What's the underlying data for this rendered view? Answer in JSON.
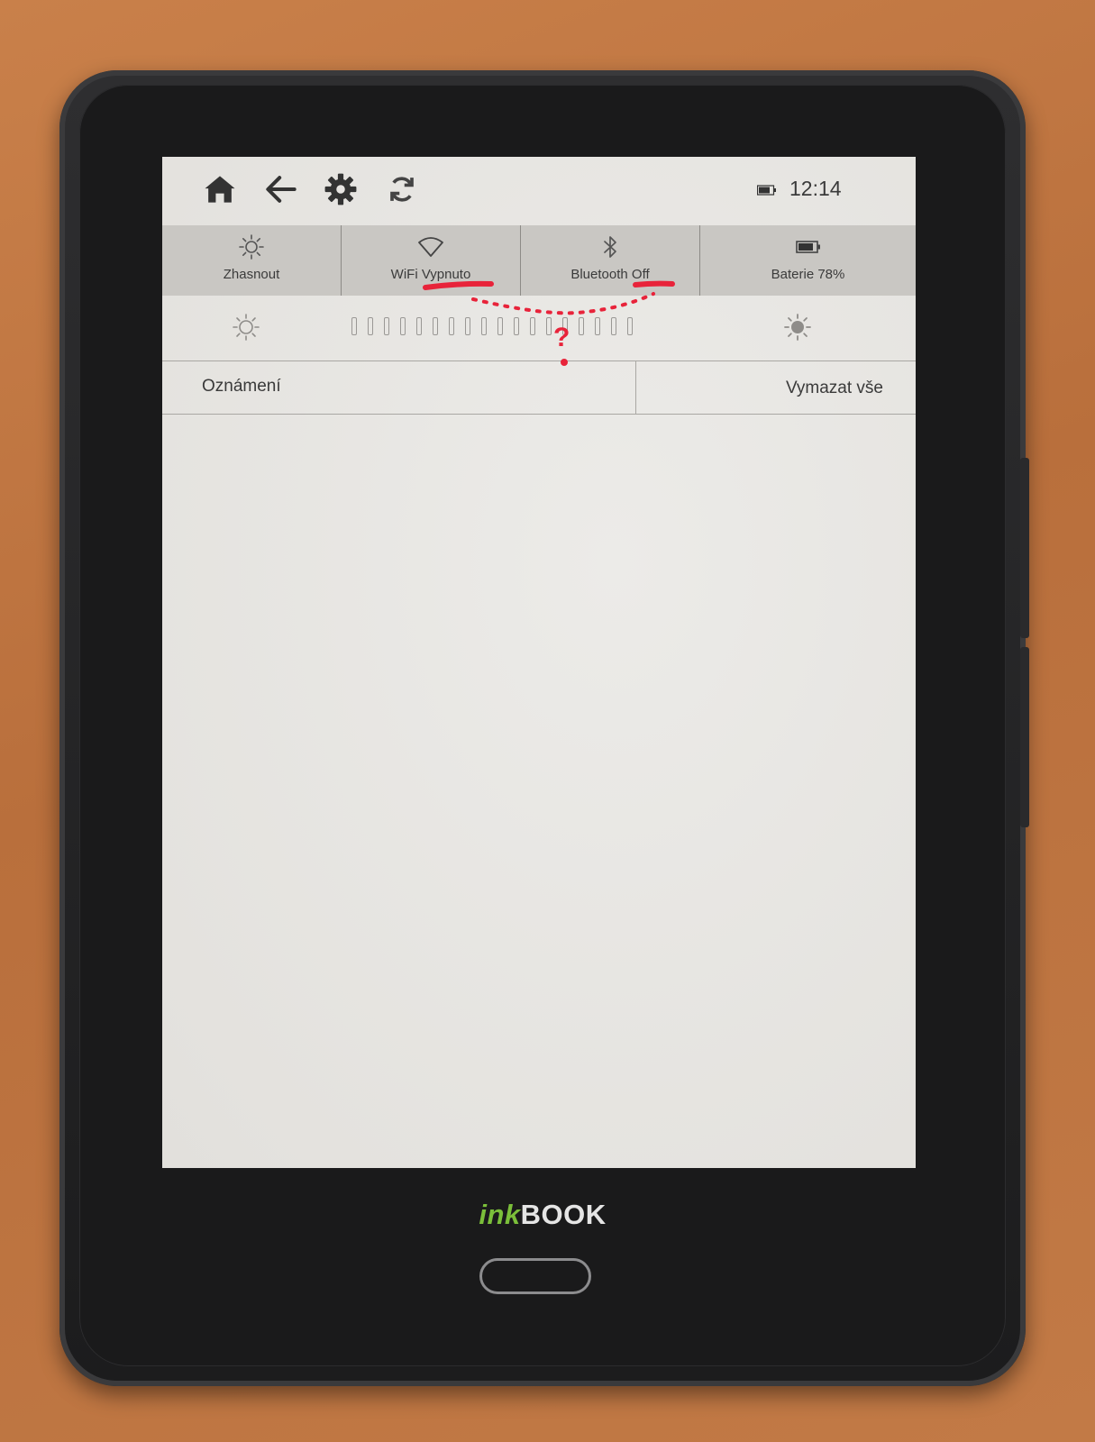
{
  "statusbar": {
    "icons": [
      "home-icon",
      "back-arrow-icon",
      "settings-gear-icon",
      "sync-icon"
    ],
    "battery_icon": "battery-icon",
    "time": "12:14"
  },
  "quick_settings": {
    "tiles": [
      {
        "icon": "sun-outline-icon",
        "label": "Zhasnout"
      },
      {
        "icon": "wifi-icon",
        "label": "WiFi Vypnuto"
      },
      {
        "icon": "bluetooth-icon",
        "label": "Bluetooth Off"
      },
      {
        "icon": "battery-icon",
        "label": "Baterie 78%"
      }
    ]
  },
  "brightness": {
    "segments_total": 18,
    "level_fraction": 0.0
  },
  "notifications": {
    "title": "Oznámení",
    "clear_all": "Vymazat vše",
    "items": []
  },
  "annotation": {
    "mark": "?",
    "color": "#e8233a"
  },
  "device": {
    "brand_prefix": "ink",
    "brand_suffix": "BOOK",
    "brand_prefix_color": "#7bbf3a"
  }
}
